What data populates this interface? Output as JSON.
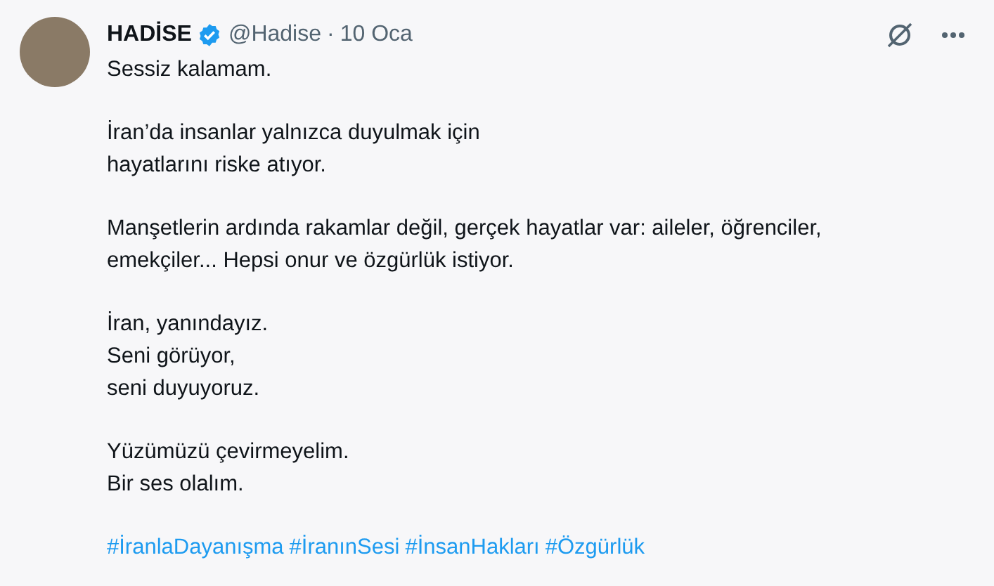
{
  "author": {
    "name": "HADİSE",
    "verified": true,
    "handle": "@Hadise",
    "separator": "·",
    "date": "10 Oca"
  },
  "paragraphs": [
    [
      "Sessiz kalamam."
    ],
    [
      "İran’da insanlar yalnızca duyulmak için",
      "hayatlarını riske atıyor."
    ],
    [
      "Manşetlerin ardında rakamlar değil, gerçek hayatlar var: aileler, öğrenciler,",
      "emekçiler... Hepsi onur ve özgürlük istiyor."
    ],
    [
      "İran, yanındayız.",
      "Seni görüyor,",
      "seni duyuyoruz."
    ],
    [
      "Yüzümüzü çevirmeyelim.",
      "Bir ses olalım."
    ]
  ],
  "hashtags": [
    "#İranlaDayanışma",
    "#İranınSesi",
    "#İnsanHakları",
    "#Özgürlük"
  ]
}
